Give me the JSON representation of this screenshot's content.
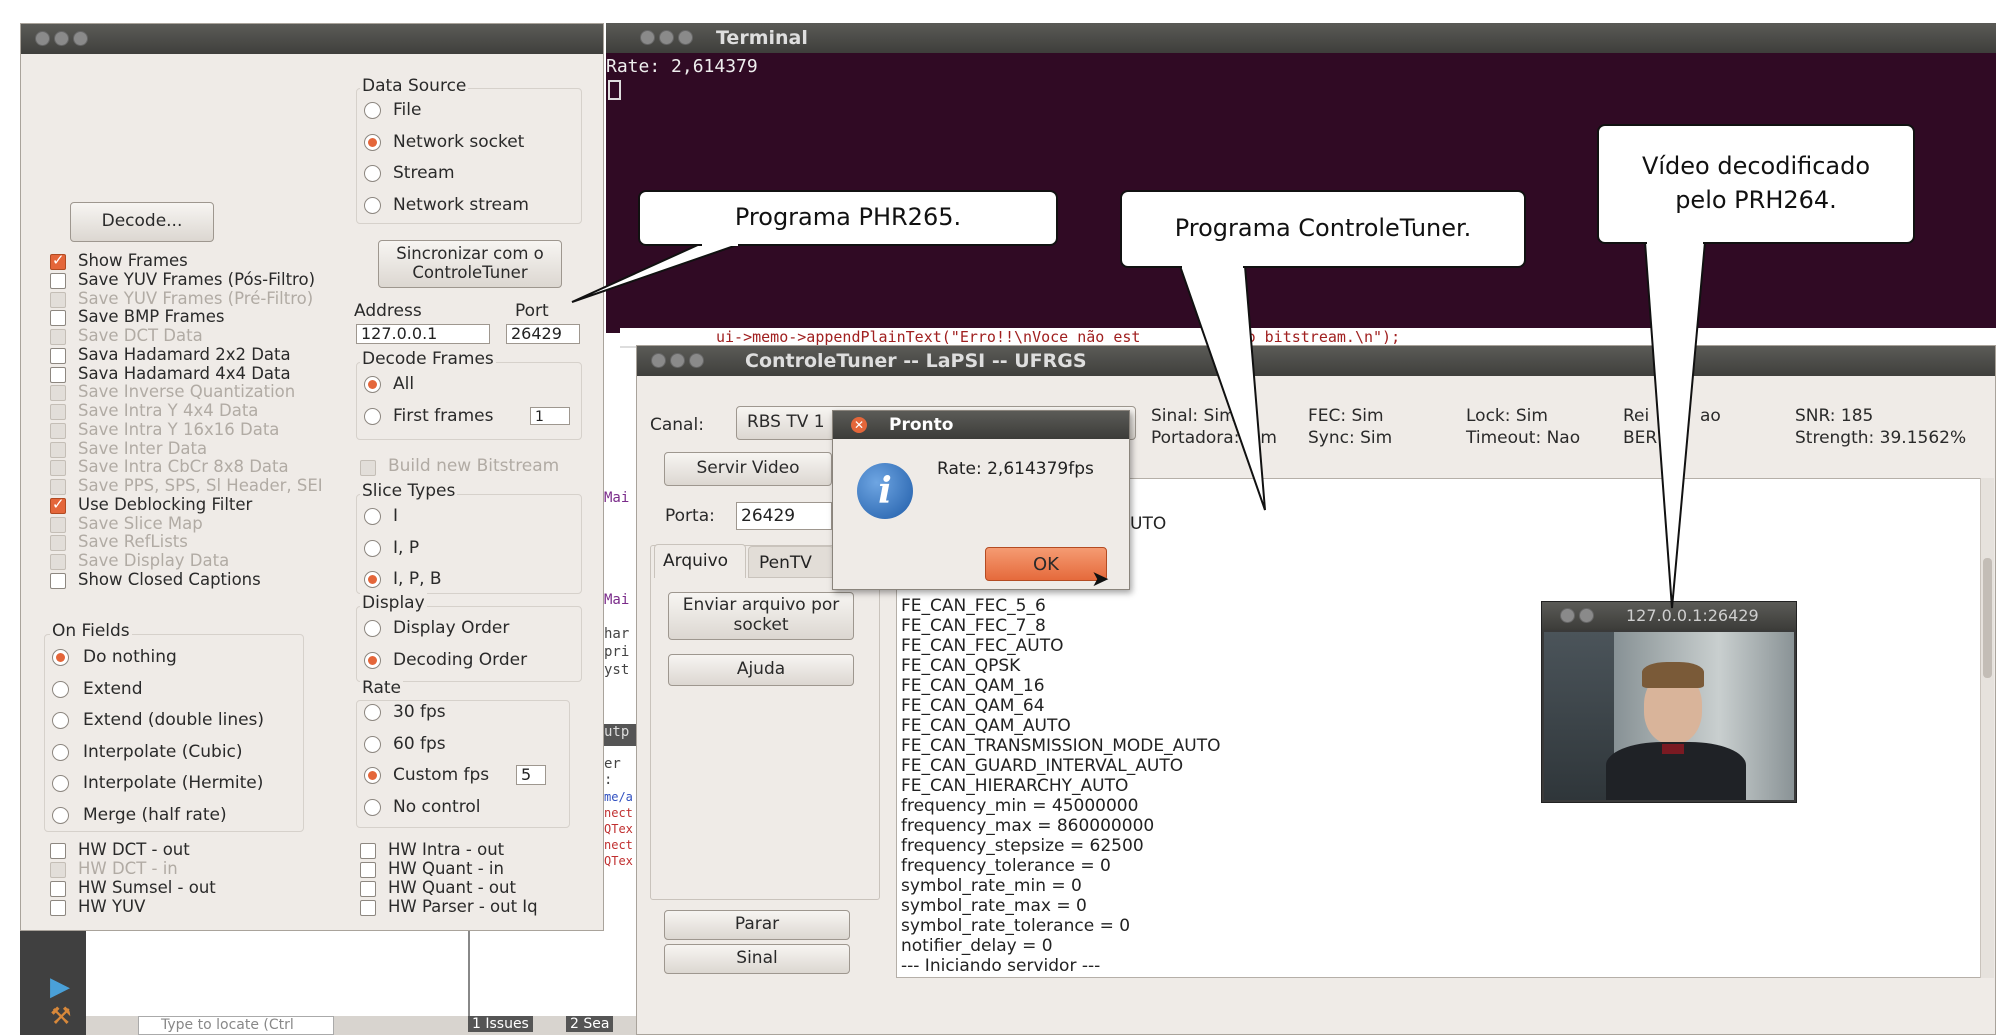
{
  "terminal": {
    "title": "Terminal",
    "line": "Rate: 2,614379"
  },
  "code_strip": "ui->memo->appendPlainText(\"Erro!!\\nVoce não est",
  "code_strip_tail": "tindo bitstream.\\n\");",
  "decoder": {
    "decode_button": "Decode...",
    "checks": [
      {
        "label": "Show Frames",
        "checked": true,
        "disabled": false
      },
      {
        "label": "Save YUV Frames (Pós-Filtro)",
        "checked": false,
        "disabled": false
      },
      {
        "label": "Save YUV Frames (Pré-Filtro)",
        "checked": false,
        "disabled": true
      },
      {
        "label": "Save BMP Frames",
        "checked": false,
        "disabled": false
      },
      {
        "label": "Save DCT Data",
        "checked": false,
        "disabled": true
      },
      {
        "label": "Sava Hadamard 2x2 Data",
        "checked": false,
        "disabled": false
      },
      {
        "label": "Sava Hadamard 4x4 Data",
        "checked": false,
        "disabled": false
      },
      {
        "label": "Save Inverse Quantization",
        "checked": false,
        "disabled": true
      },
      {
        "label": "Save Intra Y 4x4 Data",
        "checked": false,
        "disabled": true
      },
      {
        "label": "Save Intra Y 16x16 Data",
        "checked": false,
        "disabled": true
      },
      {
        "label": "Save Inter Data",
        "checked": false,
        "disabled": true
      },
      {
        "label": "Save Intra CbCr 8x8 Data",
        "checked": false,
        "disabled": true
      },
      {
        "label": "Save PPS, SPS, Sl Header, SEI",
        "checked": false,
        "disabled": true
      },
      {
        "label": "Use Deblocking Filter",
        "checked": true,
        "disabled": false
      },
      {
        "label": "Save Slice Map",
        "checked": false,
        "disabled": true
      },
      {
        "label": "Save RefLists",
        "checked": false,
        "disabled": true
      },
      {
        "label": "Save Display Data",
        "checked": false,
        "disabled": true
      },
      {
        "label": "Show Closed Captions",
        "checked": false,
        "disabled": false
      }
    ],
    "on_fields": {
      "title": "On Fields",
      "options": [
        "Do nothing",
        "Extend",
        "Extend (double lines)",
        "Interpolate (Cubic)",
        "Interpolate (Hermite)",
        "Merge (half rate)"
      ],
      "selected": 0
    },
    "hw_left": [
      "HW DCT - out",
      "HW DCT - in",
      "HW Sumsel - out",
      "HW YUV"
    ],
    "hw_left_disabled": [
      false,
      true,
      false,
      false
    ],
    "hw_right": [
      "HW Intra - out",
      "HW Quant - in",
      "HW Quant - out",
      "HW Parser - out Iq"
    ],
    "data_source": {
      "title": "Data Source",
      "options": [
        "File",
        "Network socket",
        "Stream",
        "Network stream"
      ],
      "selected": 1
    },
    "sync_button": "Sincronizar com o ControleTuner",
    "address_label": "Address",
    "port_label": "Port",
    "address_value": "127.0.0.1",
    "port_value": "26429",
    "decode_frames": {
      "title": "Decode Frames",
      "options": [
        "All",
        "First frames"
      ],
      "selected": 0,
      "first_frames_value": "1"
    },
    "build_bitstream": "Build new Bitstream",
    "slice_types": {
      "title": "Slice Types",
      "options": [
        "I",
        "I, P",
        "I, P, B"
      ],
      "selected": 2
    },
    "display": {
      "title": "Display",
      "options": [
        "Display Order",
        "Decoding Order"
      ],
      "selected": 1
    },
    "rate": {
      "title": "Rate",
      "options": [
        "30 fps",
        "60 fps",
        "Custom fps",
        "No control"
      ],
      "selected": 2,
      "custom_value": "5"
    }
  },
  "ide": {
    "bottom_bar": "Type to locate (Ctrl",
    "tabs": [
      "1 Issues",
      "2 Sea"
    ]
  },
  "code_fragments": [
    "Mai",
    "Mai",
    "har",
    "pri",
    "yst",
    "utp",
    "er :",
    "me/a",
    "nect",
    "QTex",
    "nect",
    "QTex"
  ],
  "controletuner": {
    "title": "ControleTuner -- LaPSI -- UFRGS",
    "canal_label": "Canal:",
    "canal_value": "RBS TV 1",
    "servir_button": "Servir Video",
    "porta_label": "Porta:",
    "porta_value": "26429",
    "tabs": [
      "Arquivo",
      "PenTV"
    ],
    "enviar_button": "Enviar arquivo por socket",
    "ajuda_button": "Ajuda",
    "parar_button": "Parar",
    "sinal_button": "Sinal",
    "status": {
      "sinal": "Sinal: Sim",
      "portadora": "Portadora: Sim",
      "fec": "FEC: Sim",
      "sync": "Sync: Sim",
      "lock": "Lock: Sim",
      "timeout": "Timeout: Nao",
      "rei": "Rei",
      "ao": "ao",
      "ber": "BER",
      "snr": "SNR: 185",
      "strength": "Strength: 39.1562%"
    },
    "log_partial": "UTO",
    "log": [
      "FE_CAN_FEC_5_6",
      "FE_CAN_FEC_7_8",
      "FE_CAN_FEC_AUTO",
      "FE_CAN_QPSK",
      "FE_CAN_QAM_16",
      "FE_CAN_QAM_64",
      "FE_CAN_QAM_AUTO",
      "FE_CAN_TRANSMISSION_MODE_AUTO",
      "FE_CAN_GUARD_INTERVAL_AUTO",
      "FE_CAN_HIERARCHY_AUTO",
      "frequency_min = 45000000",
      "frequency_max = 860000000",
      "frequency_stepsize = 62500",
      "frequency_tolerance = 0",
      "symbol_rate_min = 0",
      "symbol_rate_max = 0",
      "symbol_rate_tolerance = 0",
      "notifier_delay = 0",
      "--- Iniciando servidor ---"
    ]
  },
  "dialog": {
    "title": "Pronto",
    "message": "Rate: 2,614379fps",
    "ok": "OK"
  },
  "video": {
    "title": "127.0.0.1:26429"
  },
  "callouts": {
    "phr": "Programa PHR265.",
    "ctl": "Programa ControleTuner.",
    "video": "Vídeo decodificado pelo PRH264."
  },
  "colors": {
    "terminal_bg": "#300a24",
    "accent_orange": "#e4663a",
    "window_bg": "#efebe7"
  }
}
